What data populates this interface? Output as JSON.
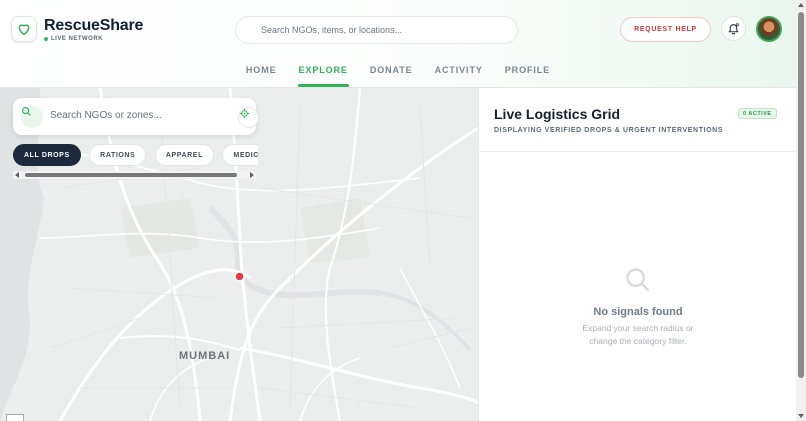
{
  "header": {
    "brand": "RescueShare",
    "live_label": "LIVE NETWORK",
    "search_placeholder": "Search NGOs, items, or locations...",
    "request_help_label": "REQUEST HELP"
  },
  "nav": {
    "items": [
      {
        "label": "HOME",
        "active": false
      },
      {
        "label": "EXPLORE",
        "active": true
      },
      {
        "label": "DONATE",
        "active": false
      },
      {
        "label": "ACTIVITY",
        "active": false
      },
      {
        "label": "PROFILE",
        "active": false
      }
    ]
  },
  "map": {
    "search_placeholder": "Search NGOs or zones...",
    "filters": [
      {
        "label": "ALL DROPS",
        "active": true
      },
      {
        "label": "RATIONS",
        "active": false
      },
      {
        "label": "APPAREL",
        "active": false
      },
      {
        "label": "MEDICAL",
        "active": false
      }
    ],
    "city_label": "MUMBAI",
    "marker_color": "#e03d3d"
  },
  "panel": {
    "title": "Live Logistics Grid",
    "subtitle": "DISPLAYING VERIFIED DROPS & URGENT INTERVENTIONS",
    "badge": "0 ACTIVE",
    "empty_title": "No signals found",
    "empty_line1": "Expand your search radius or",
    "empty_line2": "change the category filter."
  },
  "colors": {
    "accent": "#2fb25b",
    "danger": "#d93a3a",
    "dark": "#1c2a3b"
  },
  "icons": {
    "logo": "heart-icon",
    "top_search": "search-icon",
    "bell": "bell-icon",
    "map_search": "search-icon",
    "locate": "crosshair-icon",
    "empty": "search-icon"
  }
}
